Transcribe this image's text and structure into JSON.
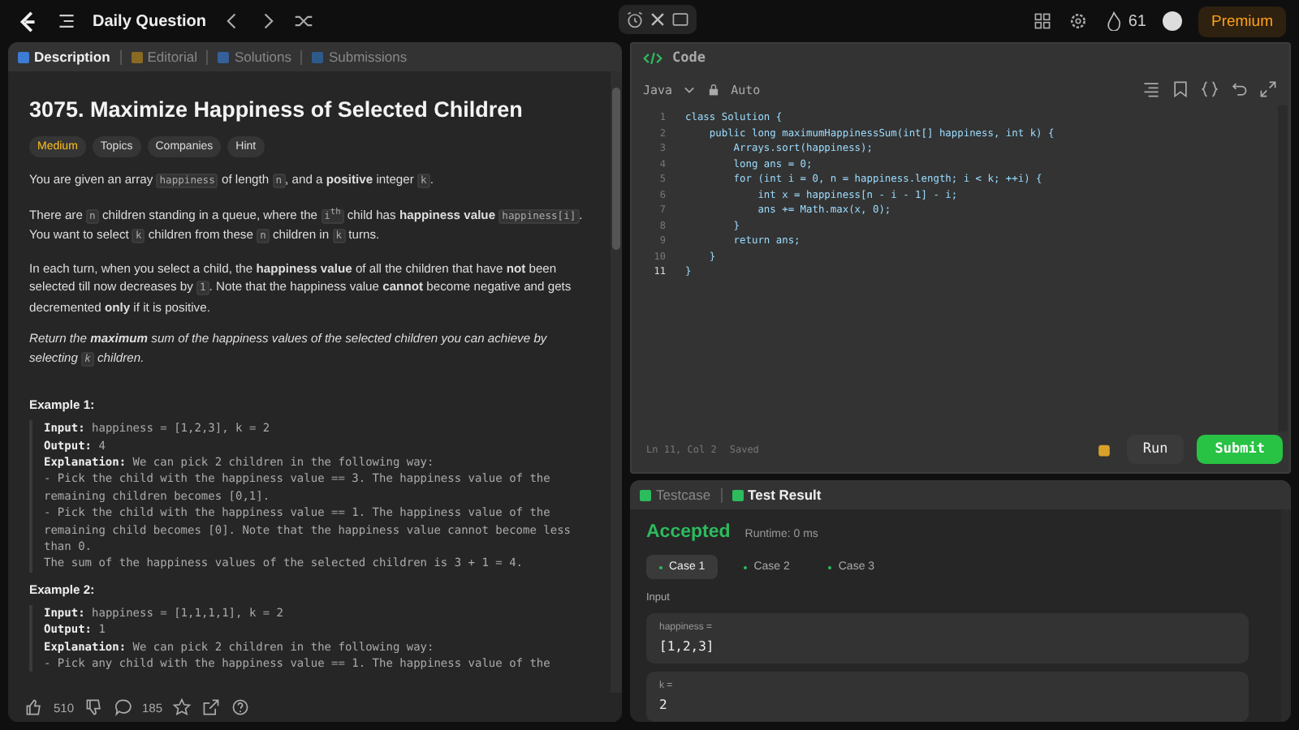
{
  "topbar": {
    "title": "Daily Question",
    "streak": "61",
    "premium": "Premium"
  },
  "tabs": [
    {
      "label": "Description",
      "selected": true
    },
    {
      "label": "Editorial",
      "selected": false
    },
    {
      "label": "Solutions",
      "selected": false
    },
    {
      "label": "Submissions",
      "selected": false
    }
  ],
  "problem": {
    "title": "3075. Maximize Happiness of Selected Children",
    "difficulty": "Medium",
    "tags": [
      "Topics",
      "Companies",
      "Hint"
    ],
    "paragraphs": [
      {
        "italic": false,
        "parts": [
          {
            "code": false,
            "s": "You are given an array "
          },
          {
            "code": true,
            "s": "happiness"
          },
          {
            "code": false,
            "s": " of length "
          },
          {
            "code": true,
            "s": "n"
          },
          {
            "code": false,
            "s": ", and a **positive** integer "
          },
          {
            "code": true,
            "s": "k"
          },
          {
            "code": false,
            "s": "."
          }
        ]
      },
      {
        "italic": false,
        "parts": [
          {
            "code": false,
            "s": "There are "
          },
          {
            "code": true,
            "s": "n"
          },
          {
            "code": false,
            "s": " children standing in a queue, where the "
          },
          {
            "code": true,
            "s": "i$^{th}$"
          },
          {
            "code": false,
            "s": " child has **happiness value** "
          },
          {
            "code": true,
            "s": "happiness[i]"
          },
          {
            "code": false,
            "s": ". You want to select "
          },
          {
            "code": true,
            "s": "k"
          },
          {
            "code": false,
            "s": " children from these "
          },
          {
            "code": true,
            "s": "n"
          },
          {
            "code": false,
            "s": " children in "
          },
          {
            "code": true,
            "s": "k"
          },
          {
            "code": false,
            "s": " turns."
          }
        ]
      },
      {
        "italic": false,
        "parts": [
          {
            "code": false,
            "s": "In each turn, when you select a child, the **happiness value** of all the children that have **not** been selected till now decreases by "
          },
          {
            "code": true,
            "s": "1"
          },
          {
            "code": false,
            "s": ". Note that the happiness value **cannot** become negative and gets decremented **only** if it is positive."
          }
        ]
      },
      {
        "italic": true,
        "parts": [
          {
            "code": false,
            "s": "Return the **maximum** sum of the happiness values of the selected children you can achieve by selecting "
          },
          {
            "code": true,
            "s": "k"
          },
          {
            "code": false,
            "s": " children."
          }
        ]
      }
    ],
    "examples": [
      {
        "heading": "Example 1:",
        "lines": [
          "**Input:** happiness = [1,2,3], k = 2",
          "**Output:** 4",
          "**Explanation:** We can pick 2 children in the following way:",
          "- Pick the child with the happiness value == 3. The happiness value of the remaining children becomes [0,1].",
          "- Pick the child with the happiness value == 1. The happiness value of the remaining child becomes [0]. Note that the happiness value cannot become less than 0.",
          "The sum of the happiness values of the selected children is 3 + 1 = 4."
        ]
      },
      {
        "heading": "Example 2:",
        "lines": [
          "**Input:** happiness = [1,1,1,1], k = 2",
          "**Output:** 1",
          "**Explanation:** We can pick 2 children in the following way:",
          "- Pick any child with the happiness value == 1. The happiness value of the"
        ]
      }
    ],
    "likes": "510",
    "comments": "185"
  },
  "code": {
    "title": "Code",
    "language": "Java",
    "mode": "Auto",
    "lines": [
      {
        "no": "1",
        "current": false,
        "text": "class Solution {"
      },
      {
        "no": "2",
        "current": false,
        "text": "    public long maximumHappinessSum(int[] happiness, int k) {"
      },
      {
        "no": "3",
        "current": false,
        "text": "        Arrays.sort(happiness);"
      },
      {
        "no": "4",
        "current": false,
        "text": "        long ans = 0;"
      },
      {
        "no": "5",
        "current": false,
        "text": "        for (int i = 0, n = happiness.length; i < k; ++i) {"
      },
      {
        "no": "6",
        "current": false,
        "text": "            int x = happiness[n - i - 1] - i;"
      },
      {
        "no": "7",
        "current": false,
        "text": "            ans += Math.max(x, 0);"
      },
      {
        "no": "8",
        "current": false,
        "text": "        }"
      },
      {
        "no": "9",
        "current": false,
        "text": "        return ans;"
      },
      {
        "no": "10",
        "current": false,
        "text": "    }"
      },
      {
        "no": "11",
        "current": true,
        "text": "}"
      }
    ],
    "status": "Ln 11, Col 2",
    "saved": "Saved",
    "run": "Run",
    "submit": "Submit"
  },
  "result_tabs": [
    {
      "label": "Testcase",
      "selected": false
    },
    {
      "label": "Test Result",
      "selected": true
    }
  ],
  "result": {
    "verdict": "Accepted",
    "runtime": "Runtime: 0 ms",
    "cases": [
      {
        "label": "Case 1",
        "selected": true
      },
      {
        "label": "Case 2",
        "selected": false
      },
      {
        "label": "Case 3",
        "selected": false
      }
    ],
    "input_label": "Input",
    "inputs": [
      {
        "name": "happiness =",
        "value": "[1,2,3]"
      },
      {
        "name": "k =",
        "value": "2"
      }
    ]
  }
}
